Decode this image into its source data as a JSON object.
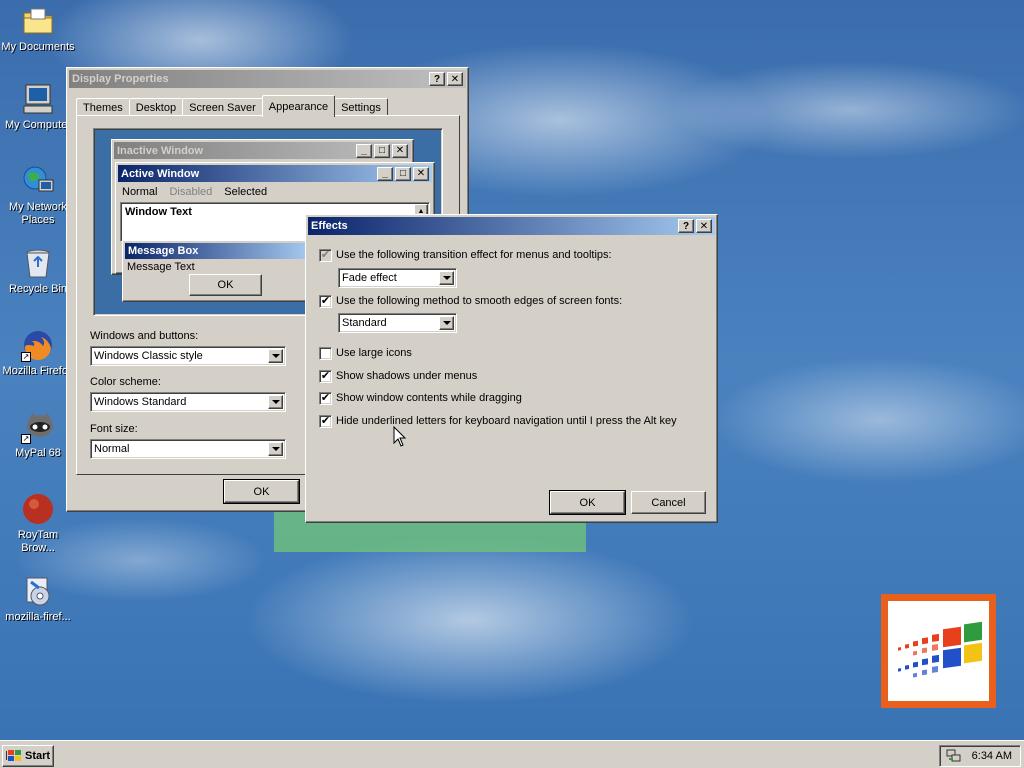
{
  "desktop": {
    "icons": [
      {
        "label": "My Documents"
      },
      {
        "label": "My Computer"
      },
      {
        "label": "My Network Places"
      },
      {
        "label": "Recycle Bin"
      },
      {
        "label": "Mozilla Firefox"
      },
      {
        "label": "MyPal 68"
      },
      {
        "label": "RoyTam Brow..."
      },
      {
        "label": "mozilla-firef..."
      }
    ]
  },
  "display_properties": {
    "title": "Display Properties",
    "tabs": [
      "Themes",
      "Desktop",
      "Screen Saver",
      "Appearance",
      "Settings"
    ],
    "active_tab": "Appearance",
    "preview": {
      "inactive_title": "Inactive Window",
      "active_title": "Active Window",
      "menu_normal": "Normal",
      "menu_disabled": "Disabled",
      "menu_selected": "Selected",
      "window_text": "Window Text",
      "message_box_title": "Message Box",
      "message_text": "Message Text",
      "ok_label": "OK"
    },
    "windows_buttons_label": "Windows and buttons:",
    "windows_buttons_value": "Windows Classic style",
    "color_scheme_label": "Color scheme:",
    "color_scheme_value": "Windows Standard",
    "font_size_label": "Font size:",
    "font_size_value": "Normal",
    "ok_label": "OK"
  },
  "effects": {
    "title": "Effects",
    "transition_label": "Use the following transition effect for menus and tooltips:",
    "transition_checked": true,
    "transition_value": "Fade effect",
    "smooth_label": "Use the following method to smooth edges of screen fonts:",
    "smooth_checked": true,
    "smooth_value": "Standard",
    "large_icons_label": "Use large icons",
    "large_icons_checked": false,
    "shadows_label": "Show shadows under menus",
    "shadows_checked": true,
    "drag_label": "Show window contents while dragging",
    "drag_checked": true,
    "underline_label": "Hide underlined letters for keyboard navigation until I press the Alt key",
    "underline_checked": true,
    "ok_label": "OK",
    "cancel_label": "Cancel"
  },
  "taskbar": {
    "start_label": "Start",
    "clock": "6:34 AM"
  },
  "colors": {
    "desktop": "#3a6ea5",
    "active_title_start": "#0a246a",
    "active_title_end": "#a6caf0",
    "face": "#d4d0c8",
    "logo_border": "#e8601c"
  }
}
